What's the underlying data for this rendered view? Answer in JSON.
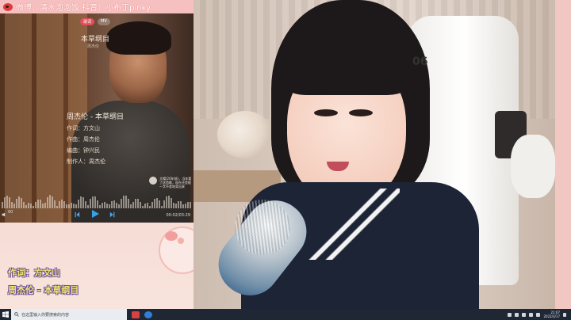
{
  "banner": {
    "text": "微博：清水泡泡饭   抖音：小布丁pinky"
  },
  "player": {
    "tabs": [
      "歌词",
      "MV"
    ],
    "song_title": "本草纲目",
    "song_artist": "周杰伦",
    "lyrics": {
      "title_line": "周杰伦 - 本草纲目",
      "line1": "作词：方文山",
      "line2": "作曲：周杰伦",
      "line3": "编曲：钟兴民",
      "line4": "制作人：周杰伦"
    },
    "comment": "大帽(20年前)，当年看了这首歌，现在还是能一字不差地背出来",
    "time_left": "00",
    "time_right": "00:02/03:29"
  },
  "credits": {
    "lyricist": "作词：方文山",
    "song": "周杰伦 - 本草纲目"
  },
  "camera": {
    "chair_text": "06"
  },
  "taskbar": {
    "search_placeholder": "在这里输入你要搜索的内容",
    "clock_time": "21:07",
    "clock_date": "2022/3/17"
  },
  "colors": {
    "banner_bg": "#f5bebe",
    "credit_fill": "#f2e86a",
    "credit_outline": "#6a4aa6",
    "play_accent": "#3aa0e8",
    "taskbar_bg": "#1f2735"
  }
}
